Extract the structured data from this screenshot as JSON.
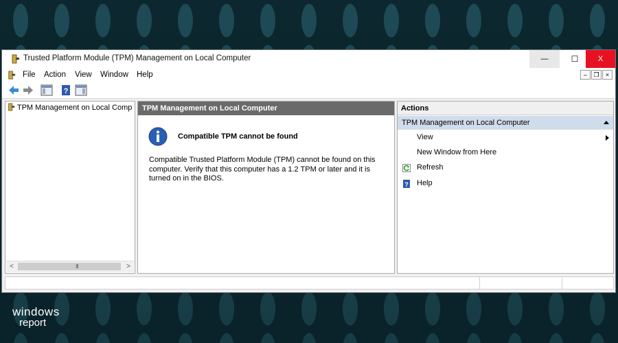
{
  "window": {
    "title": "Trusted Platform Module (TPM) Management on Local Computer",
    "min_glyph": "—",
    "max_glyph": "☐",
    "close_glyph": "X",
    "close_color": "#e81123"
  },
  "menu": {
    "items": [
      "File",
      "Action",
      "View",
      "Window",
      "Help"
    ],
    "mdi_minimize": "–",
    "mdi_restore": "❐",
    "mdi_close": "×"
  },
  "toolbar": {
    "icons": [
      "back-arrow-icon",
      "forward-arrow-icon",
      "show-hide-console-tree-icon",
      "help-icon",
      "show-hide-action-pane-icon"
    ]
  },
  "tree": {
    "root_label": "TPM Management on Local Comp",
    "scroll_left": "<",
    "scroll_right": ">",
    "scroll_grip": "III"
  },
  "center": {
    "header": "TPM Management on Local Computer",
    "message_title": "Compatible TPM cannot be found",
    "message_body": "Compatible Trusted Platform Module (TPM) cannot be found on this computer. Verify that this computer has a 1.2 TPM or later and it is turned on in the BIOS."
  },
  "actions": {
    "header": "Actions",
    "section": "TPM Management on Local Computer",
    "items": [
      {
        "label": "View",
        "icon": "",
        "submenu": true
      },
      {
        "label": "New Window from Here",
        "icon": ""
      },
      {
        "label": "Refresh",
        "icon": "refresh-icon"
      },
      {
        "label": "Help",
        "icon": "help-icon"
      }
    ]
  },
  "logo": {
    "line1": "windows",
    "line2": "report"
  },
  "colors": {
    "accent_selected": "#cfdceb",
    "center_header_bg": "#6a6a6a",
    "info_blue": "#2a5fb4"
  }
}
